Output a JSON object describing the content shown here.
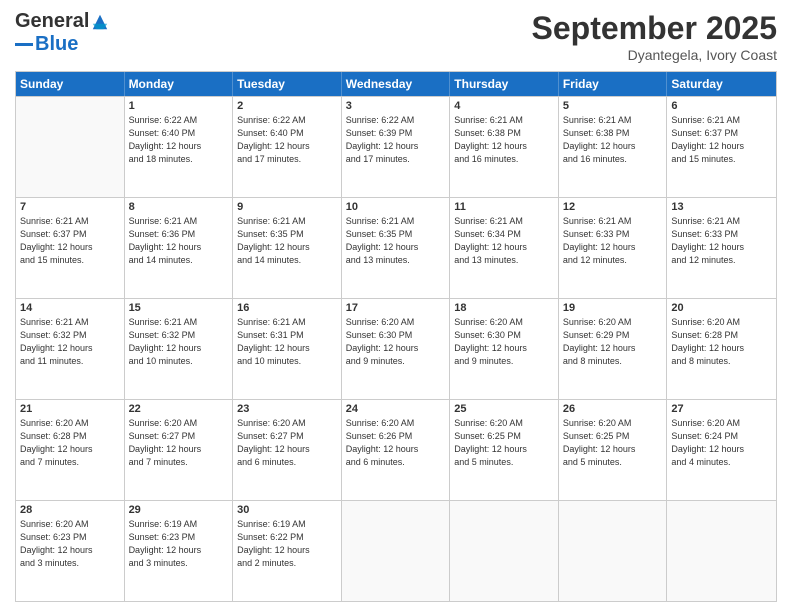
{
  "logo": {
    "general": "General",
    "blue": "Blue"
  },
  "header": {
    "month": "September 2025",
    "location": "Dyantegela, Ivory Coast"
  },
  "weekdays": [
    "Sunday",
    "Monday",
    "Tuesday",
    "Wednesday",
    "Thursday",
    "Friday",
    "Saturday"
  ],
  "rows": [
    [
      {
        "day": "",
        "info": ""
      },
      {
        "day": "1",
        "info": "Sunrise: 6:22 AM\nSunset: 6:40 PM\nDaylight: 12 hours\nand 18 minutes."
      },
      {
        "day": "2",
        "info": "Sunrise: 6:22 AM\nSunset: 6:40 PM\nDaylight: 12 hours\nand 17 minutes."
      },
      {
        "day": "3",
        "info": "Sunrise: 6:22 AM\nSunset: 6:39 PM\nDaylight: 12 hours\nand 17 minutes."
      },
      {
        "day": "4",
        "info": "Sunrise: 6:21 AM\nSunset: 6:38 PM\nDaylight: 12 hours\nand 16 minutes."
      },
      {
        "day": "5",
        "info": "Sunrise: 6:21 AM\nSunset: 6:38 PM\nDaylight: 12 hours\nand 16 minutes."
      },
      {
        "day": "6",
        "info": "Sunrise: 6:21 AM\nSunset: 6:37 PM\nDaylight: 12 hours\nand 15 minutes."
      }
    ],
    [
      {
        "day": "7",
        "info": "Sunrise: 6:21 AM\nSunset: 6:37 PM\nDaylight: 12 hours\nand 15 minutes."
      },
      {
        "day": "8",
        "info": "Sunrise: 6:21 AM\nSunset: 6:36 PM\nDaylight: 12 hours\nand 14 minutes."
      },
      {
        "day": "9",
        "info": "Sunrise: 6:21 AM\nSunset: 6:35 PM\nDaylight: 12 hours\nand 14 minutes."
      },
      {
        "day": "10",
        "info": "Sunrise: 6:21 AM\nSunset: 6:35 PM\nDaylight: 12 hours\nand 13 minutes."
      },
      {
        "day": "11",
        "info": "Sunrise: 6:21 AM\nSunset: 6:34 PM\nDaylight: 12 hours\nand 13 minutes."
      },
      {
        "day": "12",
        "info": "Sunrise: 6:21 AM\nSunset: 6:33 PM\nDaylight: 12 hours\nand 12 minutes."
      },
      {
        "day": "13",
        "info": "Sunrise: 6:21 AM\nSunset: 6:33 PM\nDaylight: 12 hours\nand 12 minutes."
      }
    ],
    [
      {
        "day": "14",
        "info": "Sunrise: 6:21 AM\nSunset: 6:32 PM\nDaylight: 12 hours\nand 11 minutes."
      },
      {
        "day": "15",
        "info": "Sunrise: 6:21 AM\nSunset: 6:32 PM\nDaylight: 12 hours\nand 10 minutes."
      },
      {
        "day": "16",
        "info": "Sunrise: 6:21 AM\nSunset: 6:31 PM\nDaylight: 12 hours\nand 10 minutes."
      },
      {
        "day": "17",
        "info": "Sunrise: 6:20 AM\nSunset: 6:30 PM\nDaylight: 12 hours\nand 9 minutes."
      },
      {
        "day": "18",
        "info": "Sunrise: 6:20 AM\nSunset: 6:30 PM\nDaylight: 12 hours\nand 9 minutes."
      },
      {
        "day": "19",
        "info": "Sunrise: 6:20 AM\nSunset: 6:29 PM\nDaylight: 12 hours\nand 8 minutes."
      },
      {
        "day": "20",
        "info": "Sunrise: 6:20 AM\nSunset: 6:28 PM\nDaylight: 12 hours\nand 8 minutes."
      }
    ],
    [
      {
        "day": "21",
        "info": "Sunrise: 6:20 AM\nSunset: 6:28 PM\nDaylight: 12 hours\nand 7 minutes."
      },
      {
        "day": "22",
        "info": "Sunrise: 6:20 AM\nSunset: 6:27 PM\nDaylight: 12 hours\nand 7 minutes."
      },
      {
        "day": "23",
        "info": "Sunrise: 6:20 AM\nSunset: 6:27 PM\nDaylight: 12 hours\nand 6 minutes."
      },
      {
        "day": "24",
        "info": "Sunrise: 6:20 AM\nSunset: 6:26 PM\nDaylight: 12 hours\nand 6 minutes."
      },
      {
        "day": "25",
        "info": "Sunrise: 6:20 AM\nSunset: 6:25 PM\nDaylight: 12 hours\nand 5 minutes."
      },
      {
        "day": "26",
        "info": "Sunrise: 6:20 AM\nSunset: 6:25 PM\nDaylight: 12 hours\nand 5 minutes."
      },
      {
        "day": "27",
        "info": "Sunrise: 6:20 AM\nSunset: 6:24 PM\nDaylight: 12 hours\nand 4 minutes."
      }
    ],
    [
      {
        "day": "28",
        "info": "Sunrise: 6:20 AM\nSunset: 6:23 PM\nDaylight: 12 hours\nand 3 minutes."
      },
      {
        "day": "29",
        "info": "Sunrise: 6:19 AM\nSunset: 6:23 PM\nDaylight: 12 hours\nand 3 minutes."
      },
      {
        "day": "30",
        "info": "Sunrise: 6:19 AM\nSunset: 6:22 PM\nDaylight: 12 hours\nand 2 minutes."
      },
      {
        "day": "",
        "info": ""
      },
      {
        "day": "",
        "info": ""
      },
      {
        "day": "",
        "info": ""
      },
      {
        "day": "",
        "info": ""
      }
    ]
  ]
}
